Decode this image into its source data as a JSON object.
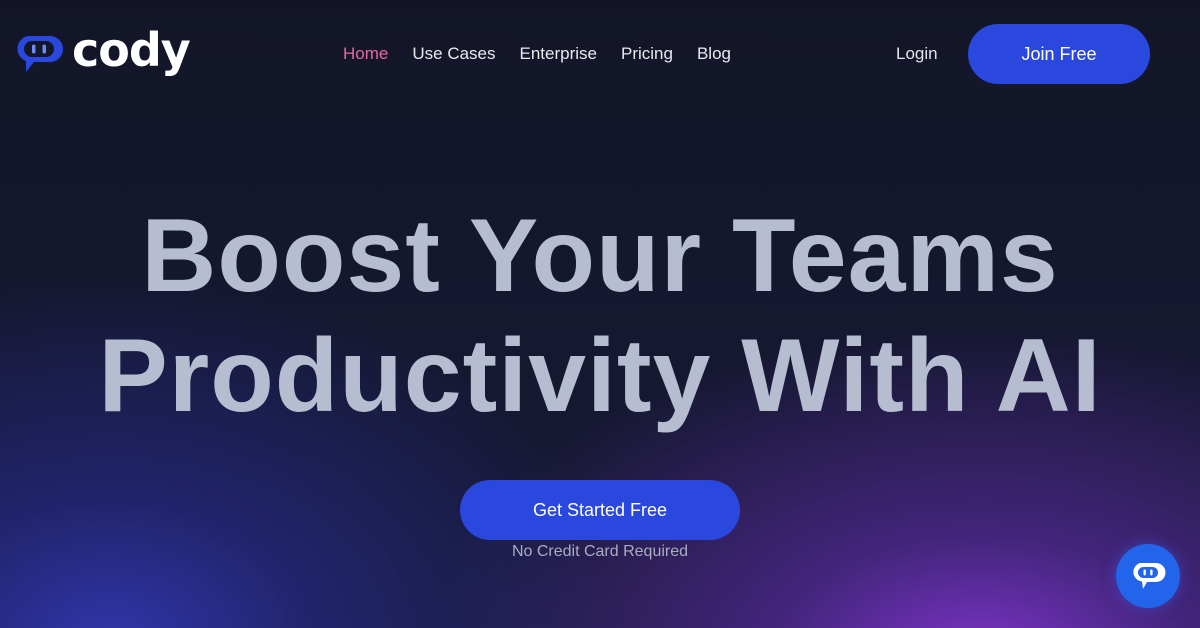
{
  "brand": {
    "name": "cody",
    "logo_icon": "chat-bot-icon",
    "accent_color": "#2a47de"
  },
  "nav": {
    "items": [
      {
        "label": "Home",
        "active": true
      },
      {
        "label": "Use Cases",
        "active": false
      },
      {
        "label": "Enterprise",
        "active": false
      },
      {
        "label": "Pricing",
        "active": false
      },
      {
        "label": "Blog",
        "active": false
      }
    ],
    "active_color": "#e36aa2"
  },
  "header": {
    "login_label": "Login",
    "join_label": "Join Free"
  },
  "hero": {
    "title_line1": "Boost Your Teams",
    "title_line2": "Productivity With AI",
    "cta_label": "Get Started Free",
    "cta_note": "No Credit Card Required"
  },
  "chat_widget": {
    "icon": "chat-bot-icon"
  }
}
